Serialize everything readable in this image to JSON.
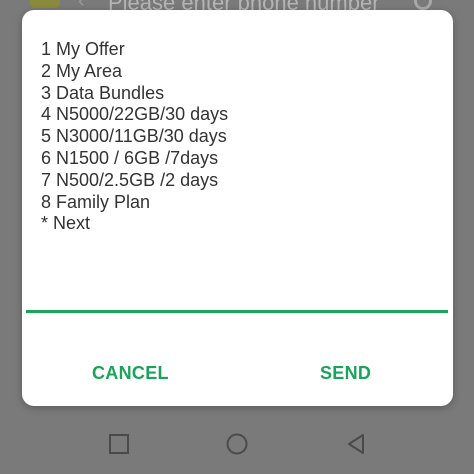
{
  "background_app": {
    "phone_input_placeholder": "Please enter phone number"
  },
  "dialog": {
    "lines": [
      "1 My Offer",
      "2 My Area",
      "3 Data Bundles",
      "4 N5000/22GB/30 days",
      "5 N3000/11GB/30 days",
      "6 N1500 / 6GB /7days",
      "7 N500/2.5GB /2 days",
      "8 Family Plan",
      "* Next"
    ],
    "reply_value": "",
    "cancel_label": "CANCEL",
    "send_label": "SEND"
  },
  "colors": {
    "accent": "#1aa35a",
    "scrim": "#7a7a7a",
    "text": "#333333"
  },
  "nav_bar": {
    "icons": [
      "recents-square-icon",
      "home-circle-icon",
      "back-triangle-icon"
    ]
  }
}
